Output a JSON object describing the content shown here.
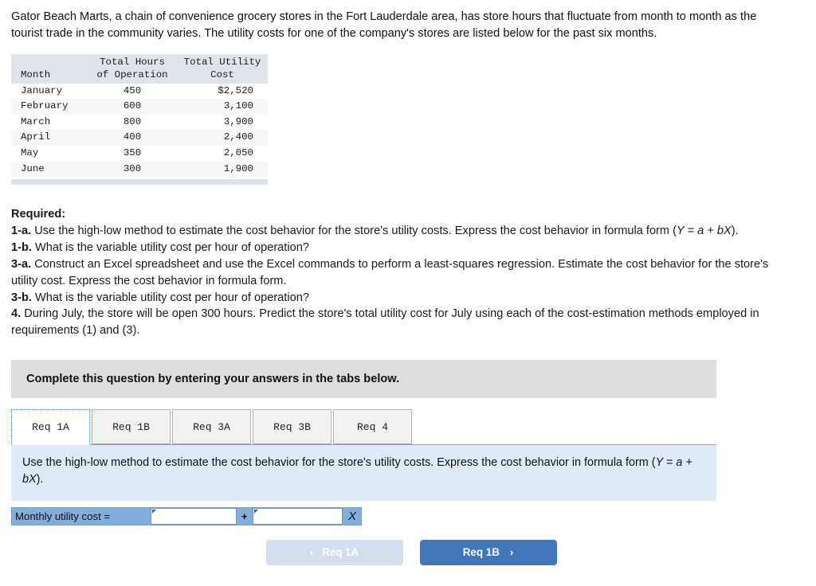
{
  "intro": "Gator Beach Marts, a chain of convenience grocery stores in the Fort Lauderdale area, has store hours that fluctuate from month to month as the tourist trade in the community varies. The utility costs for one of the company's stores are listed below for the past six months.",
  "data_table": {
    "headers": {
      "month": "Month",
      "hours": "Total Hours\nof Operation",
      "cost": "Total Utility\nCost"
    },
    "rows": [
      {
        "month": "January",
        "hours": "450",
        "cost": "$2,520"
      },
      {
        "month": "February",
        "hours": "600",
        "cost": "3,100"
      },
      {
        "month": "March",
        "hours": "800",
        "cost": "3,900"
      },
      {
        "month": "April",
        "hours": "400",
        "cost": "2,400"
      },
      {
        "month": "May",
        "hours": "350",
        "cost": "2,050"
      },
      {
        "month": "June",
        "hours": "300",
        "cost": "1,900"
      }
    ]
  },
  "required": {
    "heading": "Required:",
    "items": [
      {
        "label": "1-a.",
        "text_before": "Use the high-low method to estimate the cost behavior for the store's utility costs. Express the cost behavior in formula form (",
        "italic": "Y = a + bX",
        "text_after": ")."
      },
      {
        "label": "1-b.",
        "text_before": "What is the variable utility cost per hour of operation?",
        "italic": "",
        "text_after": ""
      },
      {
        "label": "3-a.",
        "text_before": "Construct an Excel spreadsheet and use the Excel commands to perform a least-squares regression. Estimate the cost behavior for the store's utility cost. Express the cost behavior in formula form.",
        "italic": "",
        "text_after": ""
      },
      {
        "label": "3-b.",
        "text_before": "What is the variable utility cost per hour of operation?",
        "italic": "",
        "text_after": ""
      },
      {
        "label": "4.",
        "text_before": "During July, the store will be open 300 hours. Predict the store's total utility cost for July using each of the cost-estimation methods employed in requirements (1) and (3).",
        "italic": "",
        "text_after": ""
      }
    ]
  },
  "banner": {
    "text": "Complete this question by entering your answers in the tabs below."
  },
  "tabs": [
    {
      "label": "Req 1A",
      "active": true
    },
    {
      "label": "Req 1B",
      "active": false
    },
    {
      "label": "Req 3A",
      "active": false
    },
    {
      "label": "Req 3B",
      "active": false
    },
    {
      "label": "Req 4",
      "active": false
    }
  ],
  "panel": {
    "prompt_before": "Use the high-low method to estimate the cost behavior for the store's utility costs. Express the cost behavior in formula form (",
    "prompt_italic": "Y = a + bX",
    "prompt_after": ")."
  },
  "answer_row": {
    "label": "Monthly utility cost =",
    "field_a_value": "",
    "field_b_value": "",
    "operator": "+",
    "variable": "X"
  },
  "nav": {
    "prev_label": "Req 1A",
    "prev_chevron": "‹",
    "next_label": "Req 1B",
    "next_chevron": "›"
  },
  "colors": {
    "accent_blue": "#4376b8",
    "disabled_blue": "#d4deec",
    "panel_blue": "#dfeaf7",
    "answer_row_blue": "#82aede",
    "banner_gray": "#dddddd",
    "table_header_gray": "#dfe3ea"
  }
}
